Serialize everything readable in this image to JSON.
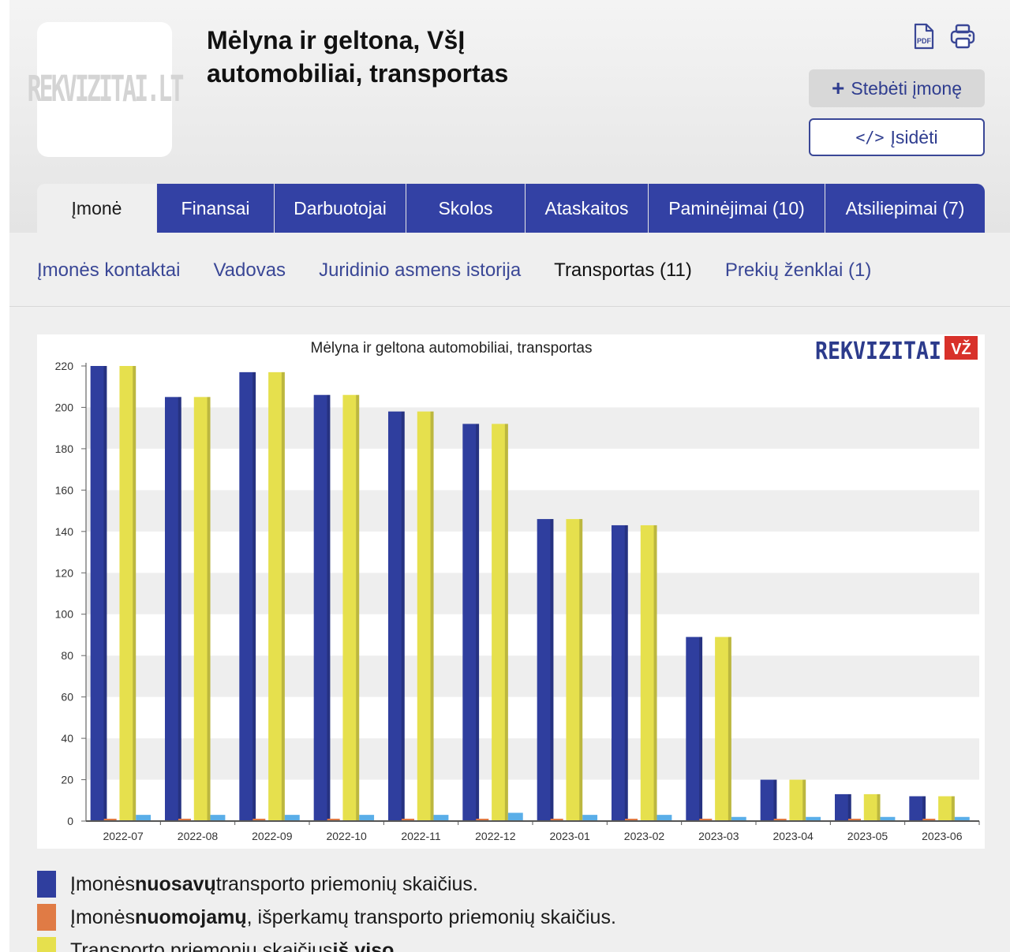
{
  "company": {
    "title": "Mėlyna ir geltona, VšĮ automobiliai, transportas",
    "logo_text": "REKVIZITAI.LT"
  },
  "actions": {
    "pdf_icon": "pdf-icon",
    "print_icon": "printer-icon",
    "follow_label": "Stebėti įmonę",
    "embed_label": "Įsidėti"
  },
  "tabs": [
    {
      "label": "Įmonė",
      "active": true
    },
    {
      "label": "Finansai"
    },
    {
      "label": "Darbuotojai"
    },
    {
      "label": "Skolos"
    },
    {
      "label": "Ataskaitos"
    },
    {
      "label": "Paminėjimai (10)"
    },
    {
      "label": "Atsiliepimai (7)"
    }
  ],
  "subnav": [
    {
      "label": "Įmonės kontaktai"
    },
    {
      "label": "Vadovas"
    },
    {
      "label": "Juridinio asmens istorija"
    },
    {
      "label": "Transportas (11)",
      "active": true
    },
    {
      "label": "Prekių ženklai (1)"
    }
  ],
  "chart_data": {
    "type": "bar",
    "title": "Mėlyna ir geltona automobiliai, transportas",
    "brand": "REKVIZITAI",
    "brand_badge": "VŽ",
    "categories": [
      "2022-07",
      "2022-08",
      "2022-09",
      "2022-10",
      "2022-11",
      "2022-12",
      "2023-01",
      "2023-02",
      "2023-03",
      "2023-04",
      "2023-05",
      "2023-06"
    ],
    "series": [
      {
        "name": "Įmonės nuosavų transporto priemonių skaičius.",
        "color": "#2f3e9e",
        "values": [
          220,
          205,
          217,
          206,
          198,
          192,
          146,
          143,
          89,
          20,
          13,
          12
        ]
      },
      {
        "name": "Įmonės nuomojamų, išperkamų transporto priemonių skaičius.",
        "color": "#e07b45",
        "values": [
          0,
          0,
          0,
          0,
          0,
          0,
          0,
          0,
          0,
          0,
          0,
          0
        ]
      },
      {
        "name": "Transporto priemonių skaičius iš viso.",
        "color": "#e6e04d",
        "values": [
          220,
          205,
          217,
          206,
          198,
          192,
          146,
          143,
          89,
          20,
          13,
          12
        ]
      },
      {
        "name": "",
        "color": "#5aaee8",
        "values": [
          3,
          3,
          3,
          3,
          3,
          4,
          3,
          3,
          2,
          2,
          2,
          2
        ]
      }
    ],
    "yticks": [
      0,
      20,
      40,
      60,
      80,
      100,
      120,
      140,
      160,
      180,
      200,
      220
    ],
    "ylim": [
      0,
      220
    ],
    "grid": "horizontal-bands"
  },
  "legend": [
    {
      "prefix": "Įmonės ",
      "bold": "nuosavų",
      "suffix": " transporto priemonių skaičius.",
      "color": "#2f3e9e"
    },
    {
      "prefix": "Įmonės ",
      "bold": "nuomojamų",
      "suffix": ", išperkamų transporto priemonių skaičius.",
      "color": "#e07b45"
    },
    {
      "prefix": "Transporto priemonių skaičius ",
      "bold": "iš viso",
      "suffix": ".",
      "color": "#e6e04d"
    }
  ]
}
